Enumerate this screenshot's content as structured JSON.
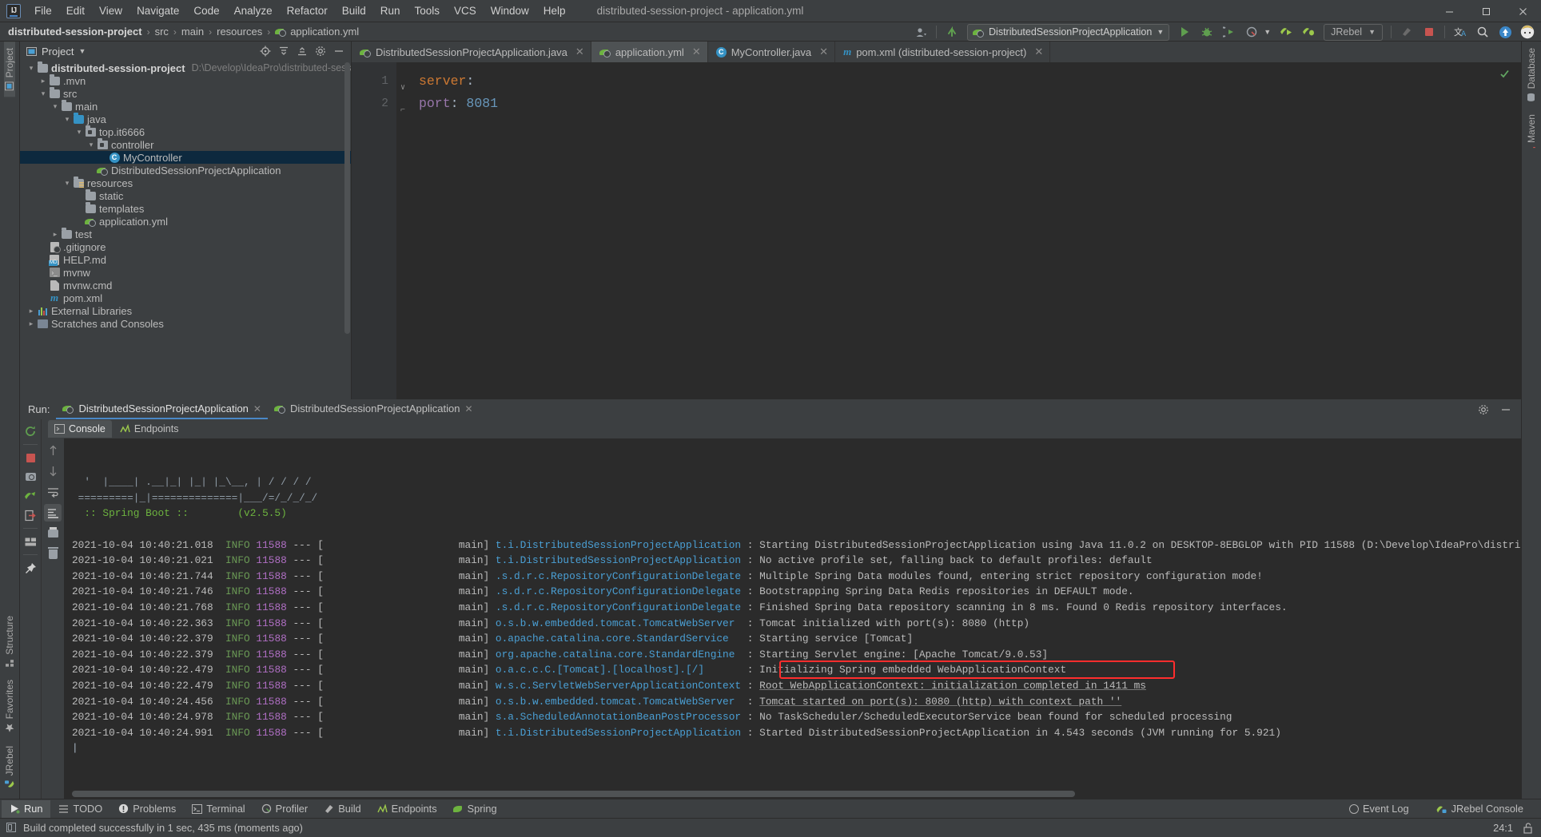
{
  "window": {
    "title": "distributed-session-project - application.yml",
    "controls": [
      "minimize",
      "maximize",
      "close"
    ]
  },
  "menubar": {
    "items": [
      "File",
      "Edit",
      "View",
      "Navigate",
      "Code",
      "Analyze",
      "Refactor",
      "Build",
      "Run",
      "Tools",
      "VCS",
      "Window",
      "Help"
    ]
  },
  "breadcrumb": {
    "items": [
      "distributed-session-project",
      "src",
      "main",
      "resources",
      "application.yml"
    ],
    "separator": "›"
  },
  "toolbar": {
    "run_config": "DistributedSessionProjectApplication",
    "jrebel_label": "JRebel",
    "icons": [
      "user-icon",
      "updates-icon",
      "run-icon",
      "debug-icon",
      "run-coverage-icon",
      "profiler-icon",
      "jrebel-run-icon",
      "jrebel-debug-icon",
      "build-icon",
      "stop-icon",
      "translate-icon",
      "search-icon",
      "update-project-icon",
      "avatar-icon"
    ]
  },
  "project_panel": {
    "title": "Project",
    "header_icons": [
      "locate-icon",
      "collapse-all-icon",
      "expand-all-icon",
      "settings-icon",
      "hide-icon"
    ],
    "tree": [
      {
        "depth": 0,
        "arrow": "∨",
        "icon": "module-folder-icon",
        "label": "distributed-session-project",
        "bold": true,
        "path": "D:\\Develop\\IdeaPro\\distributed-session-project",
        "selected": false
      },
      {
        "depth": 1,
        "arrow": "›",
        "icon": "folder-icon",
        "label": ".mvn",
        "bold": false,
        "path": "",
        "selected": false
      },
      {
        "depth": 1,
        "arrow": "∨",
        "icon": "folder-icon",
        "label": "src",
        "bold": false,
        "path": "",
        "selected": false
      },
      {
        "depth": 2,
        "arrow": "∨",
        "icon": "folder-icon",
        "label": "main",
        "bold": false,
        "path": "",
        "selected": false
      },
      {
        "depth": 3,
        "arrow": "∨",
        "icon": "source-folder-icon",
        "label": "java",
        "bold": false,
        "path": "",
        "selected": false
      },
      {
        "depth": 4,
        "arrow": "∨",
        "icon": "package-icon",
        "label": "top.it6666",
        "bold": false,
        "path": "",
        "selected": false
      },
      {
        "depth": 5,
        "arrow": "∨",
        "icon": "package-icon",
        "label": "controller",
        "bold": false,
        "path": "",
        "selected": false
      },
      {
        "depth": 6,
        "arrow": "",
        "icon": "java-class-icon",
        "label": "MyController",
        "bold": false,
        "path": "",
        "selected": true
      },
      {
        "depth": 5,
        "arrow": "",
        "icon": "spring-boot-class-icon",
        "label": "DistributedSessionProjectApplication",
        "bold": false,
        "path": "",
        "selected": false
      },
      {
        "depth": 3,
        "arrow": "∨",
        "icon": "resources-folder-icon",
        "label": "resources",
        "bold": false,
        "path": "",
        "selected": false
      },
      {
        "depth": 4,
        "arrow": "",
        "icon": "folder-icon",
        "label": "static",
        "bold": false,
        "path": "",
        "selected": false
      },
      {
        "depth": 4,
        "arrow": "",
        "icon": "folder-icon",
        "label": "templates",
        "bold": false,
        "path": "",
        "selected": false
      },
      {
        "depth": 4,
        "arrow": "",
        "icon": "spring-yml-icon",
        "label": "application.yml",
        "bold": false,
        "path": "",
        "selected": false
      },
      {
        "depth": 2,
        "arrow": "›",
        "icon": "folder-icon",
        "label": "test",
        "bold": false,
        "path": "",
        "selected": false
      },
      {
        "depth": 1,
        "arrow": "",
        "icon": "gitignore-icon",
        "label": ".gitignore",
        "bold": false,
        "path": "",
        "selected": false
      },
      {
        "depth": 1,
        "arrow": "",
        "icon": "markdown-icon",
        "label": "HELP.md",
        "bold": false,
        "path": "",
        "selected": false
      },
      {
        "depth": 1,
        "arrow": "",
        "icon": "shell-script-icon",
        "label": "mvnw",
        "bold": false,
        "path": "",
        "selected": false
      },
      {
        "depth": 1,
        "arrow": "",
        "icon": "cmd-file-icon",
        "label": "mvnw.cmd",
        "bold": false,
        "path": "",
        "selected": false
      },
      {
        "depth": 1,
        "arrow": "",
        "icon": "maven-icon",
        "label": "pom.xml",
        "bold": false,
        "path": "",
        "selected": false
      },
      {
        "depth": 0,
        "arrow": "›",
        "icon": "external-libraries-icon",
        "label": "External Libraries",
        "bold": false,
        "path": "",
        "selected": false
      },
      {
        "depth": 0,
        "arrow": "›",
        "icon": "scratches-icon",
        "label": "Scratches and Consoles",
        "bold": false,
        "path": "",
        "selected": false
      }
    ]
  },
  "editor": {
    "tabs": [
      {
        "label": "DistributedSessionProjectApplication.java",
        "icon": "spring-boot-class-icon",
        "active": false
      },
      {
        "label": "application.yml",
        "icon": "spring-yml-icon",
        "active": true
      },
      {
        "label": "MyController.java",
        "icon": "java-class-icon",
        "active": false
      },
      {
        "label": "pom.xml (distributed-session-project)",
        "icon": "maven-icon",
        "active": false
      }
    ],
    "lines": [
      {
        "number": "1",
        "fold": "∨",
        "tokens": [
          {
            "text": "server",
            "cls": "k-key"
          },
          {
            "text": ":",
            "cls": "k-punct"
          }
        ]
      },
      {
        "number": "2",
        "fold": "⌐",
        "tokens": [
          {
            "text": "  port",
            "cls": "k-key2"
          },
          {
            "text": ": ",
            "cls": "k-punct"
          },
          {
            "text": "8081",
            "cls": "k-num"
          }
        ]
      }
    ],
    "inspection_status": "ok"
  },
  "run_panel": {
    "label": "Run:",
    "tabs": [
      {
        "label": "DistributedSessionProjectApplication",
        "icon": "spring-boot-icon",
        "active": true
      },
      {
        "label": "DistributedSessionProjectApplication",
        "icon": "spring-boot-icon",
        "active": false
      }
    ],
    "console_tabs": [
      {
        "label": "Console",
        "icon": "console-icon",
        "active": true
      },
      {
        "label": "Endpoints",
        "icon": "endpoints-icon",
        "active": false
      }
    ],
    "sidebar_icons": [
      "rerun-icon",
      "stop-icon",
      "screenshot-icon",
      "jrebel-reload-icon",
      "export-icon",
      "layout-icon",
      "pin-icon"
    ],
    "gutter_icons": [
      "scroll-up-icon",
      "scroll-down-icon",
      "soft-wrap-icon",
      "scroll-to-end-icon",
      "print-icon",
      "clear-all-icon"
    ],
    "console_lines": [
      {
        "type": "banner",
        "text": "  '  |____| .__|_| |_| |_\\__, | / / / /"
      },
      {
        "type": "banner",
        "text": " =========|_|==============|___/=/_/_/_/"
      },
      {
        "type": "boot",
        "left": "  :: Spring Boot :: ",
        "right": "       (v2.5.5)"
      },
      {
        "type": "blank",
        "text": ""
      },
      {
        "type": "log",
        "ts": "2021-10-04 10:40:21.018",
        "level": "INFO",
        "pid": "11588",
        "thread": "main",
        "logger": "t.i.DistributedSessionProjectApplication",
        "msg": "Starting DistributedSessionProjectApplication using Java 11.0.2 on DESKTOP-8EBGLOP with PID 11588 (D:\\Develop\\IdeaPro\\distrib"
      },
      {
        "type": "log",
        "ts": "2021-10-04 10:40:21.021",
        "level": "INFO",
        "pid": "11588",
        "thread": "main",
        "logger": "t.i.DistributedSessionProjectApplication",
        "msg": "No active profile set, falling back to default profiles: default"
      },
      {
        "type": "log",
        "ts": "2021-10-04 10:40:21.744",
        "level": "INFO",
        "pid": "11588",
        "thread": "main",
        "logger": ".s.d.r.c.RepositoryConfigurationDelegate",
        "msg": "Multiple Spring Data modules found, entering strict repository configuration mode!"
      },
      {
        "type": "log",
        "ts": "2021-10-04 10:40:21.746",
        "level": "INFO",
        "pid": "11588",
        "thread": "main",
        "logger": ".s.d.r.c.RepositoryConfigurationDelegate",
        "msg": "Bootstrapping Spring Data Redis repositories in DEFAULT mode."
      },
      {
        "type": "log",
        "ts": "2021-10-04 10:40:21.768",
        "level": "INFO",
        "pid": "11588",
        "thread": "main",
        "logger": ".s.d.r.c.RepositoryConfigurationDelegate",
        "msg": "Finished Spring Data repository scanning in 8 ms. Found 0 Redis repository interfaces."
      },
      {
        "type": "log",
        "ts": "2021-10-04 10:40:22.363",
        "level": "INFO",
        "pid": "11588",
        "thread": "main",
        "logger": "o.s.b.w.embedded.tomcat.TomcatWebServer",
        "msg": "Tomcat initialized with port(s): 8080 (http)"
      },
      {
        "type": "log",
        "ts": "2021-10-04 10:40:22.379",
        "level": "INFO",
        "pid": "11588",
        "thread": "main",
        "logger": "o.apache.catalina.core.StandardService",
        "msg": "Starting service [Tomcat]"
      },
      {
        "type": "log",
        "ts": "2021-10-04 10:40:22.379",
        "level": "INFO",
        "pid": "11588",
        "thread": "main",
        "logger": "org.apache.catalina.core.StandardEngine",
        "msg": "Starting Servlet engine: [Apache Tomcat/9.0.53]"
      },
      {
        "type": "log",
        "ts": "2021-10-04 10:40:22.479",
        "level": "INFO",
        "pid": "11588",
        "thread": "main",
        "logger": "o.a.c.c.C.[Tomcat].[localhost].[/]",
        "msg": "Initializing Spring embedded WebApplicationContext"
      },
      {
        "type": "log",
        "ts": "2021-10-04 10:40:22.479",
        "level": "INFO",
        "pid": "11588",
        "thread": "main",
        "logger": "w.s.c.ServletWebServerApplicationContext",
        "msg": "Root WebApplicationContext: initialization completed in 1411 ms",
        "link": true
      },
      {
        "type": "log",
        "ts": "2021-10-04 10:40:24.456",
        "level": "INFO",
        "pid": "11588",
        "thread": "main",
        "logger": "o.s.b.w.embedded.tomcat.TomcatWebServer",
        "msg": "Tomcat started on port(s): 8080 (http) with context path ''",
        "highlight": true
      },
      {
        "type": "log",
        "ts": "2021-10-04 10:40:24.978",
        "level": "INFO",
        "pid": "11588",
        "thread": "main",
        "logger": "s.a.ScheduledAnnotationBeanPostProcessor",
        "msg": "No TaskScheduler/ScheduledExecutorService bean found for scheduled processing"
      },
      {
        "type": "log",
        "ts": "2021-10-04 10:40:24.991",
        "level": "INFO",
        "pid": "11588",
        "thread": "main",
        "logger": "t.i.DistributedSessionProjectApplication",
        "msg": "Started DistributedSessionProjectApplication in 4.543 seconds (JVM running for 5.921)"
      }
    ],
    "highlight_color": "#ff2d2d"
  },
  "left_rail": {
    "top": [
      {
        "label": "Project",
        "icon": "project-icon",
        "active": true
      }
    ],
    "bottom": [
      {
        "label": "Structure",
        "icon": "structure-icon",
        "active": false
      },
      {
        "label": "Favorites",
        "icon": "favorites-icon",
        "active": false
      },
      {
        "label": "JRebel",
        "icon": "jrebel-icon",
        "active": false
      }
    ]
  },
  "right_rail": {
    "items": [
      {
        "label": "Database",
        "icon": "database-icon"
      },
      {
        "label": "Maven",
        "icon": "maven-icon"
      }
    ]
  },
  "toolwindow_bar": {
    "items": [
      {
        "label": "Run",
        "icon": "run-icon",
        "active": true
      },
      {
        "label": "TODO",
        "icon": "todo-icon",
        "active": false
      },
      {
        "label": "Problems",
        "icon": "problems-icon",
        "active": false
      },
      {
        "label": "Terminal",
        "icon": "terminal-icon",
        "active": false
      },
      {
        "label": "Profiler",
        "icon": "profiler-icon",
        "active": false
      },
      {
        "label": "Build",
        "icon": "build-icon",
        "active": false
      },
      {
        "label": "Endpoints",
        "icon": "endpoints-icon",
        "active": false
      },
      {
        "label": "Spring",
        "icon": "spring-icon",
        "active": false
      }
    ],
    "right": [
      {
        "label": "Event Log",
        "icon": "event-log-icon"
      },
      {
        "label": "JRebel Console",
        "icon": "jrebel-icon"
      }
    ]
  },
  "statusbar": {
    "message": "Build completed successfully in 1 sec, 435 ms (moments ago)",
    "caret_position": "24:1",
    "lock_icon": "unlocked-icon"
  }
}
